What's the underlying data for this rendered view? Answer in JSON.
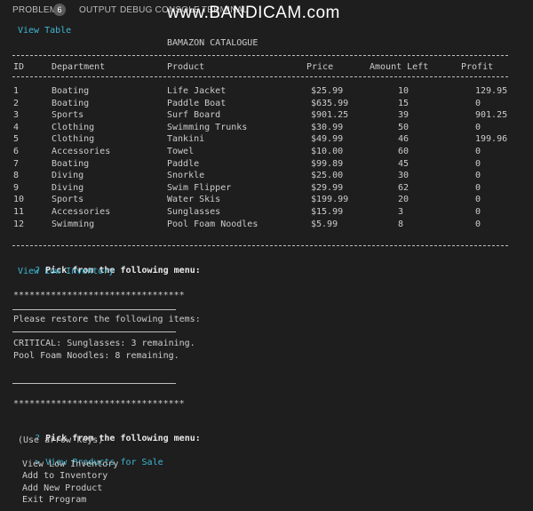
{
  "tabs": {
    "problems": "PROBLEMS",
    "problems_count": "6",
    "output": "OUTPUT",
    "debug_console": "DEBUG CONSOLE",
    "terminal": "TERMINAL"
  },
  "watermark": "www.BANDICAM.com",
  "terminal": {
    "view_table": "View Table",
    "catalogue_title": "BAMAZON CATALOGUE",
    "headers": [
      "ID",
      "Department",
      "Product",
      "Price",
      "Amount Left",
      "Profit"
    ],
    "rows": [
      [
        "1",
        "Boating",
        "Life Jacket",
        "$25.99",
        "10",
        "129.95"
      ],
      [
        "2",
        "Boating",
        "Paddle Boat",
        "$635.99",
        "15",
        "0"
      ],
      [
        "3",
        "Sports",
        "Surf Board",
        "$901.25",
        "39",
        "901.25"
      ],
      [
        "4",
        "Clothing",
        "Swimming Trunks",
        "$30.99",
        "50",
        "0"
      ],
      [
        "5",
        "Clothing",
        "Tankini",
        "$49.99",
        "46",
        "199.96"
      ],
      [
        "6",
        "Accessories",
        "Towel",
        "$10.00",
        "60",
        "0"
      ],
      [
        "7",
        "Boating",
        "Paddle",
        "$99.89",
        "45",
        "0"
      ],
      [
        "8",
        "Diving",
        "Snorkle",
        "$25.00",
        "30",
        "0"
      ],
      [
        "9",
        "Diving",
        "Swim Flipper",
        "$29.99",
        "62",
        "0"
      ],
      [
        "10",
        "Sports",
        "Water Skis",
        "$199.99",
        "20",
        "0"
      ],
      [
        "11",
        "Accessories",
        "Sunglasses",
        "$15.99",
        "3",
        "0"
      ],
      [
        "12",
        "Swimming",
        "Pool Foam Noodles",
        "$5.99",
        "8",
        "0"
      ]
    ],
    "prompt_marker": "?",
    "prompt1": "Pick from the following menu:",
    "answer1": "View Low Inventory",
    "stars1": "********************************",
    "restore_msg": "Please restore the following items:",
    "critical_line": "CRITICAL: Sunglasses: 3 remaining.",
    "low_line": "Pool Foam Noodles: 8 remaining.",
    "stars2": "********************************",
    "prompt2": "Pick from the following menu:",
    "hint": "(Use arrow keys)",
    "selected_marker": ">",
    "menu": [
      "View Products for Sale",
      "View Low Inventory",
      "Add to Inventory",
      "Add New Product",
      "Exit Program"
    ]
  }
}
